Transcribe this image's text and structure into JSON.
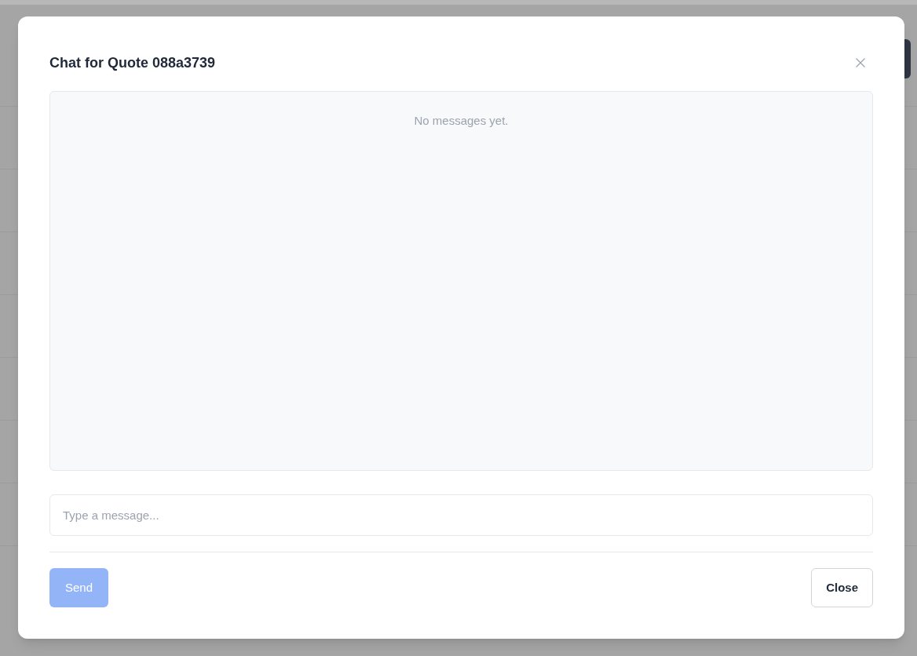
{
  "dialog": {
    "title": "Chat for Quote 088a3739"
  },
  "messages": {
    "empty_text": "No messages yet."
  },
  "composer": {
    "placeholder": "Type a message..."
  },
  "buttons": [
    {
      "kind": "primary",
      "label": "Send",
      "disabled": true
    },
    {
      "kind": "secondary",
      "label": "Close",
      "disabled": false
    }
  ]
}
